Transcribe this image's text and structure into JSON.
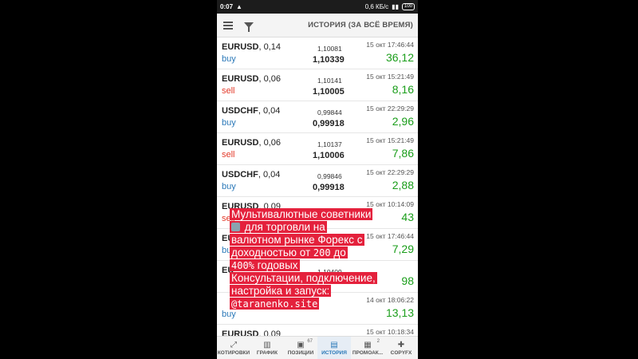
{
  "statusbar": {
    "time": "0:07",
    "warn": "▲",
    "speed": "0,6 КБ/с",
    "battery": "100"
  },
  "appbar": {
    "title": "ИСТОРИЯ (ЗА ВСЁ ВРЕМЯ)"
  },
  "trades": [
    {
      "symbol": "EURUSD",
      "volume": ", 0,14",
      "dir": "buy",
      "open": "1,10081",
      "close": "1,10339",
      "date": "15 окт 17:46:44",
      "profit": "36,12"
    },
    {
      "symbol": "EURUSD",
      "volume": ", 0,06",
      "dir": "sell",
      "open": "1,10141",
      "close": "1,10005",
      "date": "15 окт 15:21:49",
      "profit": "8,16"
    },
    {
      "symbol": "USDCHF",
      "volume": ", 0,04",
      "dir": "buy",
      "open": "0,99844",
      "close": "0,99918",
      "date": "15 окт 22:29:29",
      "profit": "2,96"
    },
    {
      "symbol": "EURUSD",
      "volume": ", 0,06",
      "dir": "sell",
      "open": "1,10137",
      "close": "1,10006",
      "date": "15 окт 15:21:49",
      "profit": "7,86"
    },
    {
      "symbol": "USDCHF",
      "volume": ", 0,04",
      "dir": "buy",
      "open": "0,99846",
      "close": "0,99918",
      "date": "15 окт 22:29:29",
      "profit": "2,88"
    },
    {
      "symbol": "EURUSD",
      "volume": ", 0,09",
      "dir": "sell",
      "open": "",
      "close": "",
      "date": "15 окт 10:14:09",
      "profit": "43"
    },
    {
      "symbol": "EURUSD",
      "volume": "",
      "dir": "buy",
      "open": "",
      "close": "",
      "date": "15 окт 17:46:44",
      "profit": "7,29"
    },
    {
      "symbol": "EU",
      "volume": "",
      "dir": "",
      "open": "1,10409",
      "close": "",
      "date": "",
      "profit": "98"
    },
    {
      "symbol": "",
      "volume": "",
      "dir": "buy",
      "open": "",
      "close": "",
      "date": "14 окт 18:06:22",
      "profit": "13,13"
    },
    {
      "symbol": "EURUSD",
      "volume": ", 0,09",
      "dir": "",
      "open": "",
      "close": "",
      "date": "15 окт 10:18:34",
      "profit": ""
    }
  ],
  "overlay": {
    "l1": "Мультивалютные советники",
    "l2": "для торговли на",
    "l3": "валютном рынке Форекс с",
    "l4a": "доходностью от",
    "l4b": "200",
    "l4c": "до",
    "l5a": "400%",
    "l5b": "годовых",
    "l6": "Консультации, подключение,",
    "l7": "настройка и запуск:",
    "l8": "@taranenko.site"
  },
  "tabs": [
    {
      "icon": "⤢",
      "label": "КОТИРОВКИ",
      "badge": ""
    },
    {
      "icon": "▥",
      "label": "ГРАФИК",
      "badge": ""
    },
    {
      "icon": "▣",
      "label": "ПОЗИЦИИ",
      "badge": "67"
    },
    {
      "icon": "▤",
      "label": "ИСТОРИЯ",
      "badge": ""
    },
    {
      "icon": "▦",
      "label": "ПРОМОАК...",
      "badge": "2"
    },
    {
      "icon": "✚",
      "label": "COPYFX",
      "badge": ""
    }
  ],
  "colors": {
    "profit": "#1b9e1b",
    "buy": "#2a78b8",
    "sell": "#e33a2a",
    "overlay": "#e4213c"
  }
}
